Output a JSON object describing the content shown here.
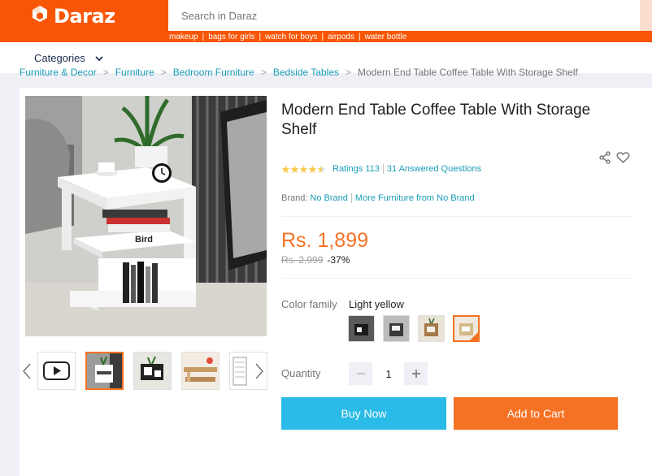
{
  "header": {
    "logo_text": "Daraz",
    "search_placeholder": "Search in Daraz",
    "keywords": [
      "makeup",
      "bags for girls",
      "watch for boys",
      "airpods",
      "water bottle"
    ]
  },
  "nav": {
    "categories_label": "Categories"
  },
  "breadcrumb": [
    "Furniture & Decor",
    "Furniture",
    "Bedroom Furniture",
    "Bedside Tables",
    "Modern End Table Coffee Table With Storage Shelf"
  ],
  "product": {
    "title": "Modern End Table Coffee Table With Storage Shelf",
    "rating_stars": 4.5,
    "ratings_label": "Ratings 113",
    "answered_label": "31 Answered Questions",
    "brand_label": "Brand:",
    "brand_value": "No Brand",
    "more_from": "More Furniture from No Brand",
    "price": "Rs. 1,899",
    "old_price": "Rs. 2,999",
    "discount": "-37%",
    "color_label": "Color family",
    "color_value": "Light yellow",
    "quantity_label": "Quantity",
    "quantity": "1",
    "buy_now": "Buy Now",
    "add_to_cart": "Add to Cart"
  },
  "colors": {
    "brand": "#f85606",
    "accent": "#f57224",
    "link": "#1a9cb7",
    "buy": "#2abbe8"
  },
  "images": {
    "main": "white-side-table-photo",
    "main_book_label": "Bird",
    "thumbnails": [
      "video-play-icon",
      "white-side-table",
      "black-white-side-table",
      "wood-table",
      "size-diagram"
    ],
    "active_thumbnail": 1,
    "swatches": [
      "dark-variant",
      "grey-variant",
      "wood-variant",
      "light-yellow-variant"
    ],
    "active_swatch": 3
  }
}
